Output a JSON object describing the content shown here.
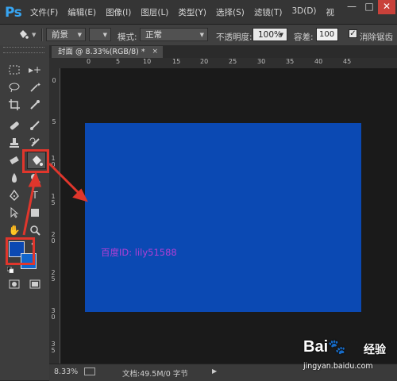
{
  "app": {
    "logo": "Ps"
  },
  "menu": [
    "文件(F)",
    "编辑(E)",
    "图像(I)",
    "图层(L)",
    "类型(Y)",
    "选择(S)",
    "滤镜(T)",
    "3D(D)",
    "视"
  ],
  "window_controls": {
    "minimize": "—",
    "maximize": "□",
    "close": "✕"
  },
  "options": {
    "tool_icon": "paint-bucket-icon",
    "fill_source": "前景",
    "pattern_value": "",
    "mode_label": "模式:",
    "mode_value": "正常",
    "opacity_label": "不透明度:",
    "opacity_value": "100%",
    "tolerance_label": "容差:",
    "tolerance_value": "100",
    "anti_alias_label": "消除锯齿",
    "anti_alias_checked": true
  },
  "document": {
    "tab_title": "封面 @ 8.33%(RGB/8) *",
    "tab_close": "×",
    "canvas_color": "#0b49b3",
    "watermark": "百度ID: lily51588"
  },
  "rulers": {
    "top": [
      "0",
      "5",
      "10",
      "15",
      "20",
      "25",
      "30",
      "35",
      "40",
      "45"
    ],
    "left": [
      "0",
      "5",
      "1 0",
      "1 5",
      "2 0",
      "2 5",
      "3 0",
      "3 5"
    ]
  },
  "status": {
    "zoom": "8.33%",
    "doc_info": "文档:49.5M/0 字节",
    "play_arrow": "▶"
  },
  "colors": {
    "foreground": "#0b49b3",
    "background": "#1166cc",
    "highlight": "#e0362c"
  },
  "branding": {
    "logo_text": "Bai",
    "logo_suffix": "百",
    "jingyan": "经验",
    "url": "jingyan.baidu.com"
  }
}
